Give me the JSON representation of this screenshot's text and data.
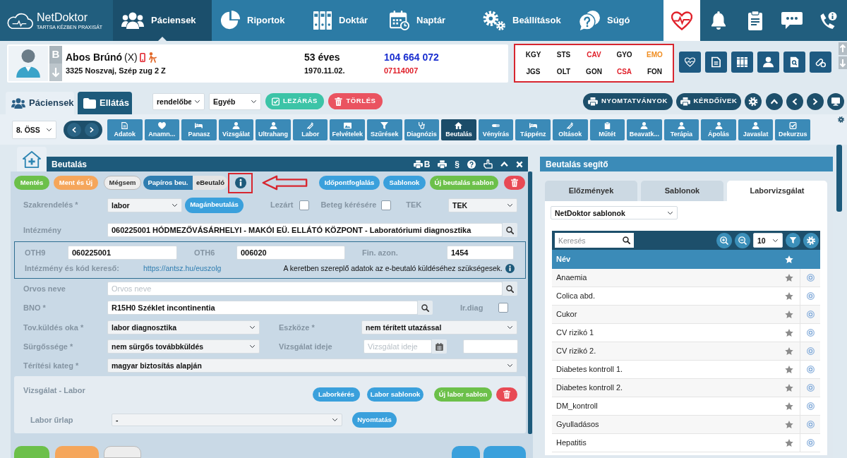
{
  "header": {
    "logo": {
      "name": "NetDoktor",
      "tagline": "TARTSA KÉZBEN PRAXISÁT"
    },
    "nav": [
      {
        "label": "Páciensek",
        "selected": true
      },
      {
        "label": "Riportok",
        "selected": false
      },
      {
        "label": "Doktár",
        "selected": false
      },
      {
        "label": "Naptár",
        "selected": false
      },
      {
        "label": "Beállítások",
        "selected": false
      },
      {
        "label": "Súgó",
        "selected": false
      }
    ],
    "tools": [
      {
        "selected": true
      },
      {
        "selected": false
      },
      {
        "selected": false
      },
      {
        "selected": false
      },
      {
        "selected": false
      }
    ]
  },
  "patient": {
    "initial": "B",
    "name": "Abos Brúnó",
    "marker": "(X)",
    "address": "3325 Noszvaj, Szép zug 2 Z",
    "age": "53 éves",
    "birth_date": "1970.11.02.",
    "insurance_number": "104 664 072",
    "patient_number": "07114007",
    "codes_framed": true,
    "codes": [
      {
        "label": "KGY",
        "color": "#111111"
      },
      {
        "label": "STS",
        "color": "#111111"
      },
      {
        "label": "CAV",
        "color": "#e0202a"
      },
      {
        "label": "GYO",
        "color": "#111111"
      },
      {
        "label": "EMO",
        "color": "#f08c1e"
      },
      {
        "label": "JGS",
        "color": "#111111"
      },
      {
        "label": "OLT",
        "color": "#111111"
      },
      {
        "label": "GON",
        "color": "#111111"
      },
      {
        "label": "CSA",
        "color": "#e0202a"
      },
      {
        "label": "FON",
        "color": "#111111"
      }
    ]
  },
  "tabs": [
    {
      "label": "Páciensek",
      "selected": false
    },
    {
      "label": "Ellátás",
      "selected": true
    }
  ],
  "toolbar": {
    "selects": [
      "rendelőbe",
      "Egyéb"
    ],
    "actions": [
      {
        "label": "LEZÁRÁS",
        "kind": "close"
      },
      {
        "label": "TÖRLÉS",
        "kind": "delete"
      }
    ],
    "print_buttons": [
      "NYOMTATVÁNYOK",
      "KÉRDŐÍVEK"
    ]
  },
  "sections": {
    "select": "8. ÖSS",
    "tabs": [
      {
        "label": "Adatok",
        "selected": false
      },
      {
        "label": "Anamn...",
        "selected": false
      },
      {
        "label": "Panasz",
        "selected": false
      },
      {
        "label": "Vizsgálat",
        "selected": false
      },
      {
        "label": "Ultrahang",
        "selected": false
      },
      {
        "label": "Labor",
        "selected": false
      },
      {
        "label": "Felvételek",
        "selected": false
      },
      {
        "label": "Szűrések",
        "selected": false
      },
      {
        "label": "Diagnózis",
        "selected": false
      },
      {
        "label": "Beutalás",
        "selected": true
      },
      {
        "label": "Vényírás",
        "selected": false
      },
      {
        "label": "Táppénz",
        "selected": false
      },
      {
        "label": "Oltások",
        "selected": false
      },
      {
        "label": "Műtét",
        "selected": false
      },
      {
        "label": "Beavatk...",
        "selected": false
      },
      {
        "label": "Terápia",
        "selected": false
      },
      {
        "label": "Ápolás",
        "selected": false
      },
      {
        "label": "Javaslat",
        "selected": false
      },
      {
        "label": "Dekurzus",
        "selected": false
      }
    ]
  },
  "referral": {
    "title": "Beutalás",
    "header_tools": [
      {
        "kind": "print",
        "text": "B"
      },
      {
        "kind": "print"
      },
      {
        "kind": "text",
        "text": "§"
      },
      {
        "kind": "help"
      },
      {
        "kind": "pointer"
      },
      {
        "kind": "collapse"
      },
      {
        "kind": "close"
      }
    ],
    "actions_left": [
      {
        "label": "Mentés",
        "kind": "green"
      },
      {
        "label": "Ment és Új",
        "kind": "orange"
      },
      {
        "label": "Mégsem",
        "kind": "light"
      }
    ],
    "mode": [
      {
        "label": "Papíros beu.",
        "selected": true
      },
      {
        "label": "eBeutaló",
        "selected": false
      }
    ],
    "info_framed": true,
    "arrow": true,
    "actions_right": [
      {
        "label": "Időpontfoglalás",
        "kind": "blue"
      },
      {
        "label": "Sablonok",
        "kind": "blue"
      },
      {
        "label": "Új beutalás sablon",
        "kind": "green"
      },
      {
        "kind": "trash"
      }
    ],
    "specialty": {
      "label": "Szakrendelés *",
      "value": "labor",
      "button": "Magánbeutalás"
    },
    "closed": {
      "label": "Lezárt",
      "checked": false
    },
    "on_request": {
      "label": "Beteg kérésére",
      "checked": false
    },
    "tek": {
      "label": "TEK",
      "value": "TEK"
    },
    "institution": {
      "label": "Intézmény",
      "value": "060225001 HÓDMEZŐVÁSÁRHELYI - MAKÓI EÜ. ELLÁTÓ KÖZPONT - Laboratóriumi diagnosztika"
    },
    "ids": [
      {
        "label": "OTH9",
        "value": "060225001"
      },
      {
        "label": "OTH6",
        "value": "006020"
      },
      {
        "label": "Fin. azon.",
        "value": "1454"
      }
    ],
    "lookup": {
      "label": "Intézmény és kód kereső:",
      "link": "https://antsz.hu/euszolg",
      "note": "A keretben szereplő adatok az e-beutaló küldéséhez szükségesek."
    },
    "doctor": {
      "label": "Orvos neve",
      "placeholder": "Orvos neve"
    },
    "bno": {
      "label": "BNO *",
      "value": "R15H0 Széklet incontinentia"
    },
    "irdiag": {
      "label": "Ir.diag",
      "checked": false
    },
    "reason": {
      "label": "Tov.küldés oka *",
      "value": "labor diagnosztika"
    },
    "transport": {
      "label": "Eszköze *",
      "value": "nem térített utazással"
    },
    "urgency": {
      "label": "Sürgőssége *",
      "value": "nem sürgős továbbküldés"
    },
    "exam_time": {
      "label": "Vizsgálat ideje",
      "placeholder": "Vizsgálat ideje"
    },
    "payment": {
      "label": "Térítési kateg *",
      "value": "magyar biztosítás alapján"
    },
    "lab": {
      "title": "Vizsgálat - Labor",
      "buttons": [
        {
          "label": "Laborkérés",
          "kind": "blue"
        },
        {
          "label": "Labor sablonok",
          "kind": "blue"
        },
        {
          "label": "Új labor sablon",
          "kind": "green"
        },
        {
          "kind": "trash"
        }
      ],
      "form_label": "Labor űrlap",
      "form_value": "-",
      "print": "Nyomtatás"
    },
    "footer_left": [
      {
        "kind": "green"
      },
      {
        "kind": "orange"
      },
      {
        "kind": "light"
      }
    ],
    "footer_right": [
      {
        "kind": "blue"
      },
      {
        "kind": "blue"
      }
    ]
  },
  "helper": {
    "title": "Beutalás segítő",
    "tabs": [
      {
        "label": "Előzmények",
        "selected": false
      },
      {
        "label": "Sablonok",
        "selected": false
      },
      {
        "label": "Laborvizsgálat",
        "selected": true
      }
    ],
    "source": "NetDoktor sablonok",
    "search_placeholder": "Keresés",
    "page_size": "10",
    "column": "Név",
    "rows": [
      {
        "name": "Anaemia",
        "favorite": false
      },
      {
        "name": "Colica abd.",
        "favorite": false
      },
      {
        "name": "Cukor",
        "favorite": false
      },
      {
        "name": "CV rizikó 1",
        "favorite": false
      },
      {
        "name": "CV rizikó 2.",
        "favorite": false
      },
      {
        "name": "Diabetes kontroll 1.",
        "favorite": false
      },
      {
        "name": "Diabetes kontroll 2.",
        "favorite": false
      },
      {
        "name": "DM_kontroll",
        "favorite": false
      },
      {
        "name": "Gyulladásos",
        "favorite": false
      },
      {
        "name": "Hepatitis",
        "favorite": false
      }
    ]
  }
}
